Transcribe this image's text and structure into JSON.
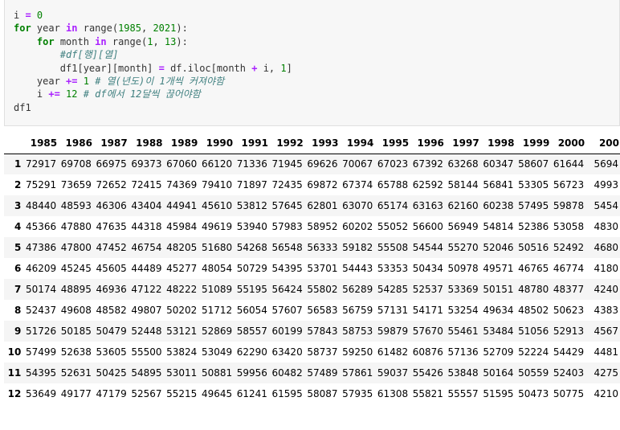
{
  "code": {
    "lines": [
      [
        {
          "t": "i ",
          "c": ""
        },
        {
          "t": "=",
          "c": "op"
        },
        {
          "t": " ",
          "c": ""
        },
        {
          "t": "0",
          "c": "num"
        }
      ],
      [
        {
          "t": "for",
          "c": "kw"
        },
        {
          "t": " year ",
          "c": ""
        },
        {
          "t": "in",
          "c": "op"
        },
        {
          "t": " range(",
          "c": ""
        },
        {
          "t": "1985",
          "c": "num"
        },
        {
          "t": ", ",
          "c": ""
        },
        {
          "t": "2021",
          "c": "num"
        },
        {
          "t": "):",
          "c": ""
        }
      ],
      [
        {
          "t": "    ",
          "c": ""
        },
        {
          "t": "for",
          "c": "kw"
        },
        {
          "t": " month ",
          "c": ""
        },
        {
          "t": "in",
          "c": "op"
        },
        {
          "t": " range(",
          "c": ""
        },
        {
          "t": "1",
          "c": "num"
        },
        {
          "t": ", ",
          "c": ""
        },
        {
          "t": "13",
          "c": "num"
        },
        {
          "t": "):",
          "c": ""
        }
      ],
      [
        {
          "t": "        ",
          "c": ""
        },
        {
          "t": "#df[행][열]",
          "c": "cm"
        }
      ],
      [
        {
          "t": "        df1[year][month] ",
          "c": ""
        },
        {
          "t": "=",
          "c": "op"
        },
        {
          "t": " df.iloc[month ",
          "c": ""
        },
        {
          "t": "+",
          "c": "op"
        },
        {
          "t": " i, ",
          "c": ""
        },
        {
          "t": "1",
          "c": "num"
        },
        {
          "t": "]",
          "c": ""
        }
      ],
      [
        {
          "t": "    year ",
          "c": ""
        },
        {
          "t": "+=",
          "c": "op"
        },
        {
          "t": " ",
          "c": ""
        },
        {
          "t": "1",
          "c": "num"
        },
        {
          "t": " ",
          "c": ""
        },
        {
          "t": "# 열(년도)이 1개씩 커져야함",
          "c": "cm"
        }
      ],
      [
        {
          "t": "    i ",
          "c": ""
        },
        {
          "t": "+=",
          "c": "op"
        },
        {
          "t": " ",
          "c": ""
        },
        {
          "t": "12",
          "c": "num"
        },
        {
          "t": " ",
          "c": ""
        },
        {
          "t": "# df에서 12달씩 끊어야함",
          "c": "cm"
        }
      ],
      [
        {
          "t": "df1",
          "c": ""
        }
      ]
    ]
  },
  "table": {
    "columns": [
      "1985",
      "1986",
      "1987",
      "1988",
      "1989",
      "1990",
      "1991",
      "1992",
      "1993",
      "1994",
      "1995",
      "1996",
      "1997",
      "1998",
      "1999",
      "2000",
      "200"
    ],
    "rows": [
      {
        "index": "1",
        "values": [
          "72917",
          "69708",
          "66975",
          "69373",
          "67060",
          "66120",
          "71336",
          "71945",
          "69626",
          "70067",
          "67023",
          "67392",
          "63268",
          "60347",
          "58607",
          "61644",
          "5694"
        ]
      },
      {
        "index": "2",
        "values": [
          "75291",
          "73659",
          "72652",
          "72415",
          "74369",
          "79410",
          "71897",
          "72435",
          "69872",
          "67374",
          "65788",
          "62592",
          "58144",
          "56841",
          "53305",
          "56723",
          "4993"
        ]
      },
      {
        "index": "3",
        "values": [
          "48440",
          "48593",
          "46306",
          "43404",
          "44941",
          "45610",
          "53812",
          "57645",
          "62801",
          "63070",
          "65174",
          "63163",
          "62160",
          "60238",
          "57495",
          "59878",
          "5454"
        ]
      },
      {
        "index": "4",
        "values": [
          "45366",
          "47880",
          "47635",
          "44318",
          "45984",
          "49619",
          "53940",
          "57983",
          "58952",
          "60202",
          "55052",
          "56600",
          "56949",
          "54814",
          "52386",
          "53058",
          "4830"
        ]
      },
      {
        "index": "5",
        "values": [
          "47386",
          "47800",
          "47452",
          "46754",
          "48205",
          "51680",
          "54268",
          "56548",
          "56333",
          "59182",
          "55508",
          "54544",
          "55270",
          "52046",
          "50516",
          "52492",
          "4680"
        ]
      },
      {
        "index": "6",
        "values": [
          "46209",
          "45245",
          "45605",
          "44489",
          "45277",
          "48054",
          "50729",
          "54395",
          "53701",
          "54443",
          "53353",
          "50434",
          "50978",
          "49571",
          "46765",
          "46774",
          "4180"
        ]
      },
      {
        "index": "7",
        "values": [
          "50174",
          "48895",
          "46936",
          "47122",
          "48222",
          "51089",
          "55195",
          "56424",
          "55802",
          "56289",
          "54285",
          "52537",
          "53369",
          "50151",
          "48780",
          "48377",
          "4240"
        ]
      },
      {
        "index": "8",
        "values": [
          "52437",
          "49608",
          "48582",
          "49807",
          "50202",
          "51712",
          "56054",
          "57607",
          "56583",
          "56759",
          "57131",
          "54171",
          "53254",
          "49634",
          "48502",
          "50623",
          "4383"
        ]
      },
      {
        "index": "9",
        "values": [
          "51726",
          "50185",
          "50479",
          "52448",
          "53121",
          "52869",
          "58557",
          "60199",
          "57843",
          "58753",
          "59879",
          "57670",
          "55461",
          "53484",
          "51056",
          "52913",
          "4567"
        ]
      },
      {
        "index": "10",
        "values": [
          "57499",
          "52638",
          "53605",
          "55500",
          "53824",
          "53049",
          "62290",
          "63420",
          "58737",
          "59250",
          "61482",
          "60876",
          "57136",
          "52709",
          "52224",
          "54429",
          "4481"
        ]
      },
      {
        "index": "11",
        "values": [
          "54395",
          "52631",
          "50425",
          "54895",
          "53011",
          "50881",
          "59956",
          "60482",
          "57489",
          "57861",
          "59037",
          "55426",
          "53848",
          "50164",
          "50559",
          "52403",
          "4275"
        ]
      },
      {
        "index": "12",
        "values": [
          "53649",
          "49177",
          "47179",
          "52567",
          "55215",
          "49645",
          "61241",
          "61595",
          "58087",
          "57935",
          "61308",
          "55821",
          "55557",
          "51595",
          "50473",
          "50775",
          "4210"
        ]
      }
    ]
  }
}
